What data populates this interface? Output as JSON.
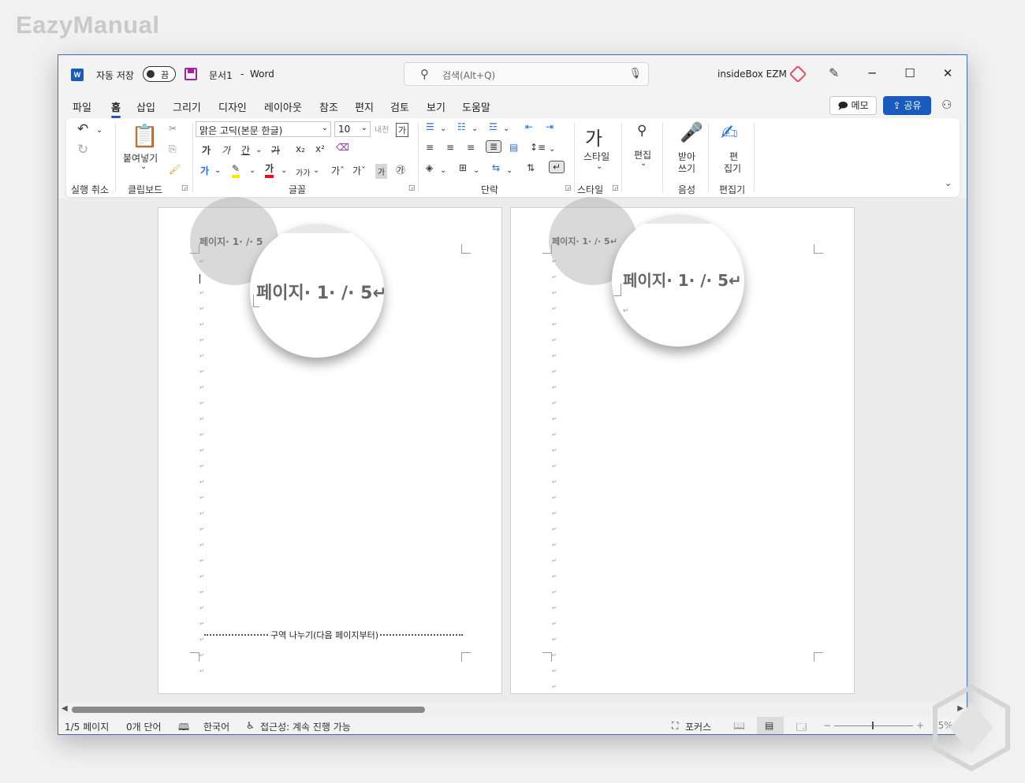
{
  "watermark": "EazyManual",
  "titlebar": {
    "autosave_label": "자동 저장",
    "autosave_state": "끔",
    "doc_name": "문서1",
    "separator": "-",
    "app_name": "Word",
    "search_placeholder": "검색(Alt+Q)",
    "user_name": "insideBox EZM",
    "minimize": "─",
    "maximize": "☐",
    "close": "✕"
  },
  "tabs": [
    "파일",
    "홈",
    "삽입",
    "그리기",
    "디자인",
    "레이아웃",
    "참조",
    "편지",
    "검토",
    "보기",
    "도움말"
  ],
  "active_tab": "홈",
  "actions": {
    "memo": "메모",
    "share": "공유"
  },
  "ribbon": {
    "undo_group": "실행 취소",
    "paste_label": "붙여넣기",
    "clipboard_group": "클립보드",
    "font_name": "맑은 고딕(본문 한글)",
    "font_size": "10",
    "font_group": "글꼴",
    "paragraph_group": "단락",
    "styles_label": "스타일",
    "styles_group": "스타일",
    "edit_label": "편집",
    "dictate_label1": "받아",
    "dictate_label2": "쓰기",
    "voice_group": "음성",
    "editor_label1": "편",
    "editor_label2": "집기",
    "editor_group": "편집기",
    "bold": "가",
    "italic": "가",
    "underline": "간",
    "strike": "가",
    "subscript": "x₂",
    "superscript": "x²",
    "font_color": "가",
    "char_shade": "가",
    "enclose": "㉮",
    "grow_font": "가ˆ",
    "shrink_font": "가ˇ",
    "change_case": "가가",
    "phonetic": "내천",
    "char_border": "가"
  },
  "pages": [
    {
      "header_text": "페이지· 1· /· 5",
      "lens_text": "페이지· 1· /· 5↵",
      "section_break": "구역 나누기(다음 페이지부터)"
    },
    {
      "header_text": "페이지· 1· /· 5↵",
      "lens_text": "페이지· 1· /· 5↵"
    }
  ],
  "statusbar": {
    "page": "1/5 페이지",
    "words": "0개 단어",
    "language": "한국어",
    "accessibility": "접근성: 계속 진행 가능",
    "focus": "포커스",
    "zoom": "55%",
    "zoom_minus": "−",
    "zoom_plus": "+"
  },
  "colors": {
    "accent": "#185abd",
    "highlight": "#ffe600",
    "font_red": "#e81123",
    "autosave_purple": "#a3239e"
  }
}
